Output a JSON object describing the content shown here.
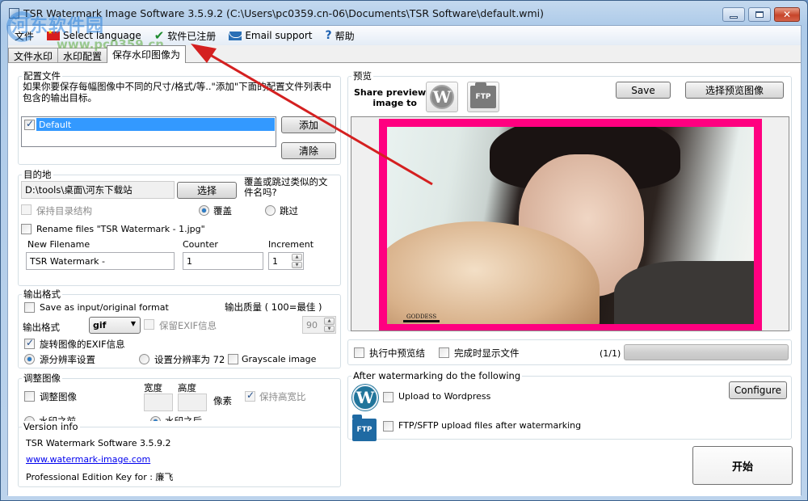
{
  "window": {
    "title": "TSR Watermark Image Software 3.5.9.2 (C:\\Users\\pc0359.cn-06\\Documents\\TSR Software\\default.wmi)",
    "controls": {
      "minimize": "minimize",
      "maximize": "maximize",
      "close": "✕"
    }
  },
  "menubar": {
    "file": "文件",
    "language": "Select language",
    "registered": "软件已注册",
    "email": "Email support",
    "help": "帮助"
  },
  "tabs": [
    {
      "label": "文件水印",
      "active": false
    },
    {
      "label": "水印配置",
      "active": false
    },
    {
      "label": "保存水印图像为",
      "active": true
    }
  ],
  "profiles": {
    "legend": "配置文件",
    "description": "如果你要保存每幅图像中不同的尺寸/格式/等..\"添加\"下面的配置文件列表中包含的输出目标。",
    "items": [
      {
        "label": "Default",
        "checked": true,
        "selected": true
      }
    ],
    "add_label": "添加",
    "clear_label": "清除"
  },
  "destination": {
    "legend": "目的地",
    "path": "D:\\tools\\桌面\\河东下载站",
    "choose_label": "选择",
    "overwrite_question": "覆盖或跳过类似的文件名吗?",
    "keep_structure_label": "保持目录结构",
    "keep_structure_checked": false,
    "overwrite_label": "覆盖",
    "skip_label": "跳过",
    "overwrite_selected": true,
    "rename_label": "Rename files \"TSR Watermark - 1.jpg\"",
    "rename_checked": false,
    "new_filename_label": "New Filename",
    "counter_label": "Counter",
    "increment_label": "Increment",
    "new_filename_value": "TSR Watermark -",
    "counter_value": "1",
    "increment_value": "1"
  },
  "output_format": {
    "legend": "输出格式",
    "save_original_label": "Save as input/original format",
    "save_original_checked": false,
    "quality_label": "输出质量 ( 100=最佳 )",
    "quality_value": "90",
    "format_label": "输出格式",
    "format_value": "gif",
    "keep_exif_label": "保留EXIF信息",
    "keep_exif_checked": false,
    "rotate_exif_label": "旋转图像的EXIF信息",
    "rotate_exif_checked": true,
    "source_dpi_label": "源分辨率设置",
    "source_dpi_selected": true,
    "set_dpi_label": "设置分辨率为 72",
    "grayscale_label": "Grayscale image",
    "grayscale_checked": false
  },
  "resize": {
    "legend": "调整图像",
    "resize_label": "调整图像",
    "resize_checked": false,
    "width_label": "宽度",
    "height_label": "高度",
    "width_value": "",
    "height_value": "",
    "pixels_label": "像素",
    "keep_ratio_label": "保持高宽比",
    "keep_ratio_checked": true,
    "before_label": "水印之前",
    "after_label": "水印之后",
    "after_selected": true
  },
  "version": {
    "legend": "Version info",
    "product": "TSR Watermark Software 3.5.9.2",
    "website": "www.watermark-image.com",
    "key_label": "Professional Edition Key for : 廉飞"
  },
  "preview": {
    "legend": "预览",
    "share_label_line1": "Share preview",
    "share_label_line2": "image to",
    "wordpress_icon": "W",
    "ftp_icon": "FTP",
    "save_label": "Save",
    "choose_image_label": "选择预览图像",
    "watermark_text": "GODDESS",
    "frame_color": "#ff0080"
  },
  "run_options": {
    "preview_during_label": "执行中预览结",
    "preview_during_checked": false,
    "show_files_label": "完成时显示文件",
    "show_files_checked": false,
    "progress_text": "(1/1)",
    "progress_fraction": 0
  },
  "after": {
    "legend": "After watermarking do the following",
    "wordpress_label": "Upload to Wordpress",
    "wordpress_checked": false,
    "ftp_label": "FTP/SFTP upload files after watermarking",
    "ftp_checked": false,
    "configure_label": "Configure",
    "wordpress_icon": "W",
    "ftp_icon": "FTP"
  },
  "start_label": "开始",
  "overlay": {
    "site_watermark": "河东软件园",
    "site_url": "www.pc0359.cn",
    "annotation_arrow_color": "#d42020"
  }
}
